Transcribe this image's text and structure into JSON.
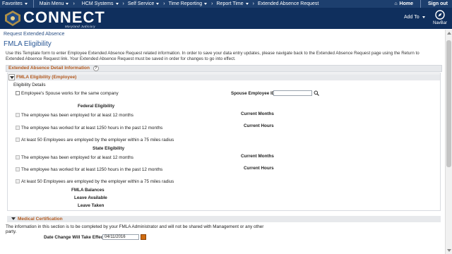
{
  "menu": {
    "items": [
      "Favorites",
      "Main Menu",
      "HCM Systems",
      "Self Service",
      "Time Reporting",
      "Report Time"
    ],
    "breadcrumb_last": "Extended Absence Request",
    "home": "Home",
    "signout": "Sign out"
  },
  "banner": {
    "logo_text": "CONNECT",
    "logo_sub": "Maryland Judiciary",
    "add_to": "Add To",
    "navbar": "NavBar"
  },
  "page": {
    "breadcrumb": "Request Extended Absence",
    "title": "FMLA Eligibility",
    "instructions": "Use this Template form to enter Employee Extended Absence Request related information. In order to save your data entry updates, please navigate back to the Extended Absence Request page using the Return to Extended Absence Request link.  Your Extended Absence Request must be saved in order for changes to go into effect."
  },
  "detail_section": {
    "title": "Extended Absence Detail Information",
    "help": "?"
  },
  "fmla": {
    "title": "FMLA Eligibility (Employee)",
    "eligibility_details": "Eligibility Details",
    "spouse_same_company": "Employee's Spouse works for the same company",
    "spouse_id_label": "Spouse Employee ID",
    "spouse_id_value": "",
    "federal_title": "Federal Eligibility",
    "federal": {
      "employed_12": "The employee has been employed for at least 12 months",
      "worked_1250": "The employee has worked for at least 1250 hours in the past 12 months",
      "employees_50": "At least 50 Employees are employed by the employer within a 75 miles radius",
      "current_months": "Current Months",
      "current_hours": "Current Hours"
    },
    "state_title": "State Eligibility",
    "state": {
      "employed_12": "The employee has been employed for at least 12 months",
      "worked_1250": "The employee has worked for at least 1250 hours in the past 12 months",
      "employees_50": "At least 50 Employees are employed by the employer within a 75 miles radius",
      "current_months": "Current Months",
      "current_hours": "Current Hours"
    },
    "balances_title": "FMLA Balances",
    "leave_available": "Leave Available",
    "leave_taken": "Leave Taken"
  },
  "medical": {
    "title": "Medical Certification",
    "note": "The information in this section is to be completed by your FMLA Administrator and will not be shared with Management or any other party.",
    "date_label": "Date Change Will Take Effect",
    "date_value": "04/11/2016"
  },
  "colors": {
    "menubar": "#1d3f6e",
    "banner": "#0f2f5d",
    "section_title": "#b35a1f",
    "page_title": "#2a5896"
  }
}
